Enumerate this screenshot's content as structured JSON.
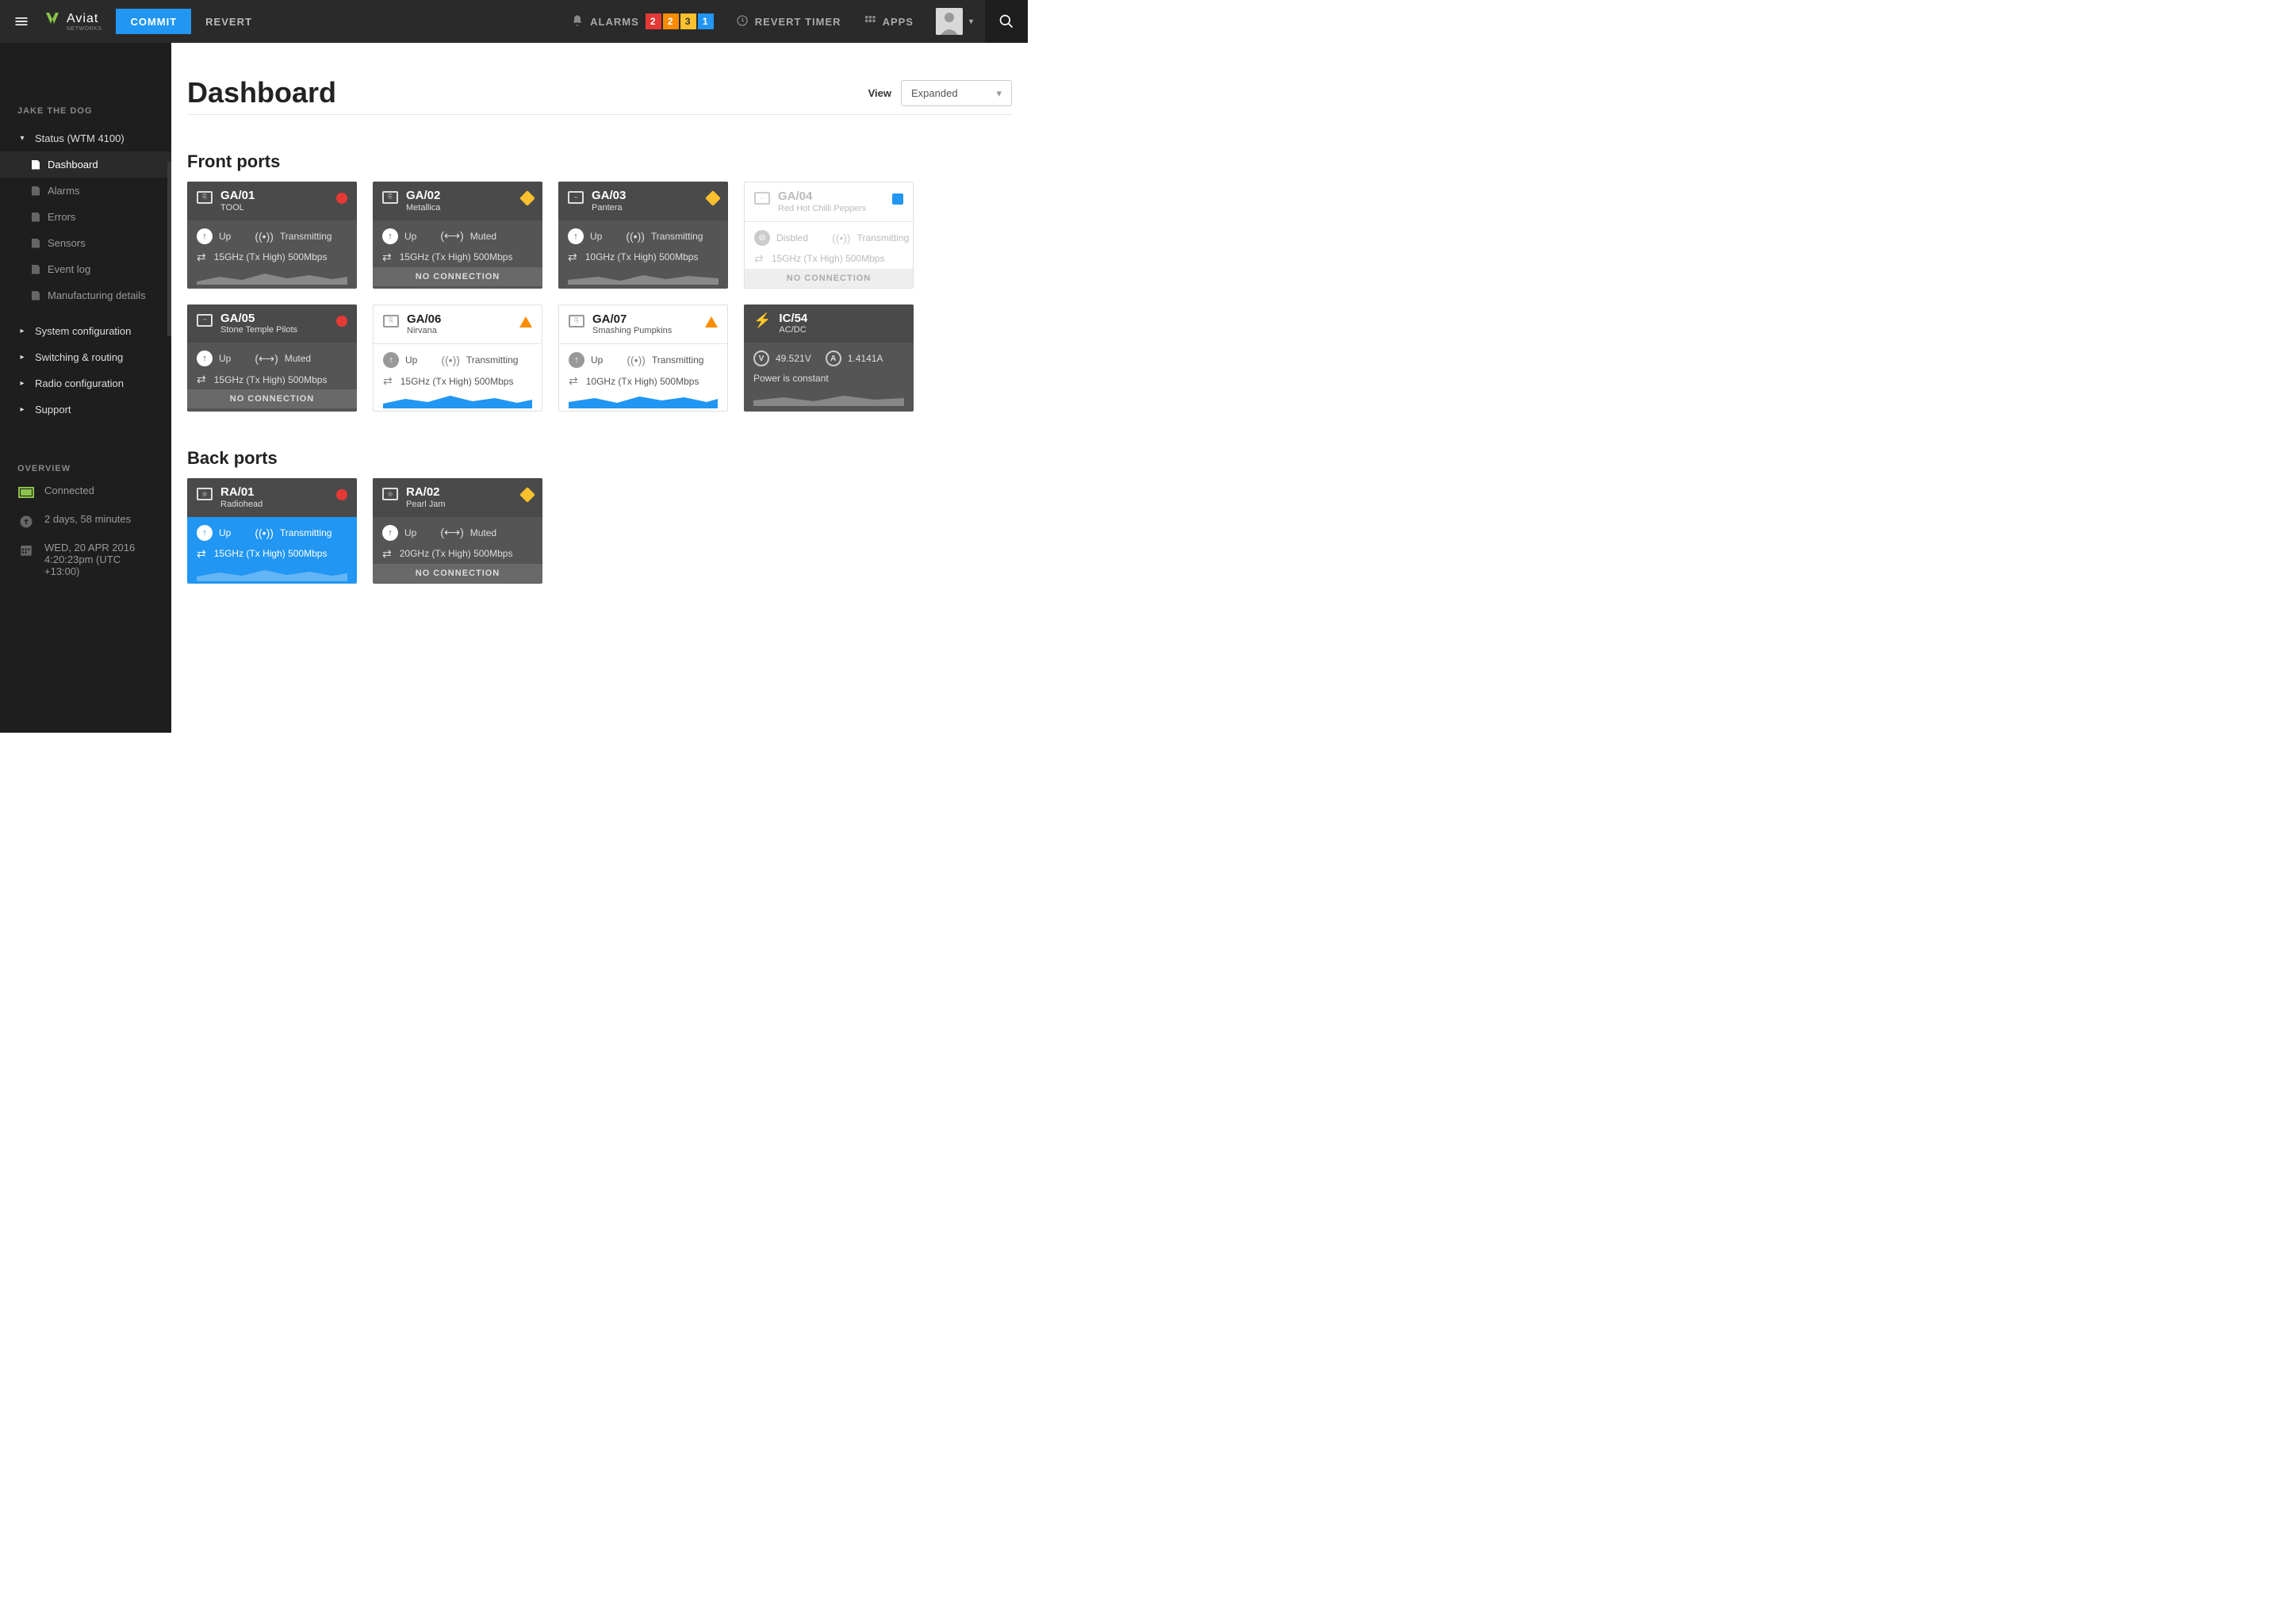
{
  "topbar": {
    "commit": "COMMIT",
    "revert": "REVERT",
    "alarms": "ALARMS",
    "alarm_counts": [
      "2",
      "2",
      "3",
      "1"
    ],
    "revert_timer": "REVERT TIMER",
    "apps": "APPS"
  },
  "brand": {
    "name": "Aviat",
    "sub": "NETWORKS"
  },
  "sidebar": {
    "user": "JAKE THE DOG",
    "status_group": "Status (WTM 4100)",
    "items": [
      "Dashboard",
      "Alarms",
      "Errors",
      "Sensors",
      "Event log",
      "Manufacturing details"
    ],
    "groups": [
      "System configuration",
      "Switching & routing",
      "Radio configuration",
      "Support"
    ],
    "overview_title": "OVERVIEW",
    "connected": "Connected",
    "uptime": "2 days, 58 minutes",
    "date": "WED, 20 APR 2016",
    "time": "4:20:23pm (UTC +13:00)"
  },
  "page": {
    "title": "Dashboard",
    "view_label": "View",
    "view_value": "Expanded"
  },
  "sections": {
    "front": "Front ports",
    "back": "Back ports"
  },
  "labels": {
    "up": "Up",
    "transmitting": "Transmitting",
    "muted": "Muted",
    "disabled": "Disbled",
    "freq15": "15GHz (Tx High) 500Mbps",
    "freq10": "10GHz (Tx High) 500Mbps",
    "freq20": "20GHz (Tx High) 500Mbps",
    "no_conn": "NO CONNECTION",
    "power_constant": "Power is constant"
  },
  "front": [
    {
      "id": "GA/01",
      "name": "TOOL"
    },
    {
      "id": "GA/02",
      "name": "Metallica"
    },
    {
      "id": "GA/03",
      "name": "Pantera"
    },
    {
      "id": "GA/04",
      "name": "Red Hot Chilli Peppers"
    },
    {
      "id": "GA/05",
      "name": "Stone Temple Pilots"
    },
    {
      "id": "GA/06",
      "name": "Nirvana"
    },
    {
      "id": "GA/07",
      "name": "Smashing Pumpkins"
    },
    {
      "id": "IC/54",
      "name": "AC/DC",
      "volt": "49.521V",
      "amp": "1.4141A"
    }
  ],
  "back": [
    {
      "id": "RA/01",
      "name": "Radiohead"
    },
    {
      "id": "RA/02",
      "name": "Pearl Jam"
    }
  ]
}
